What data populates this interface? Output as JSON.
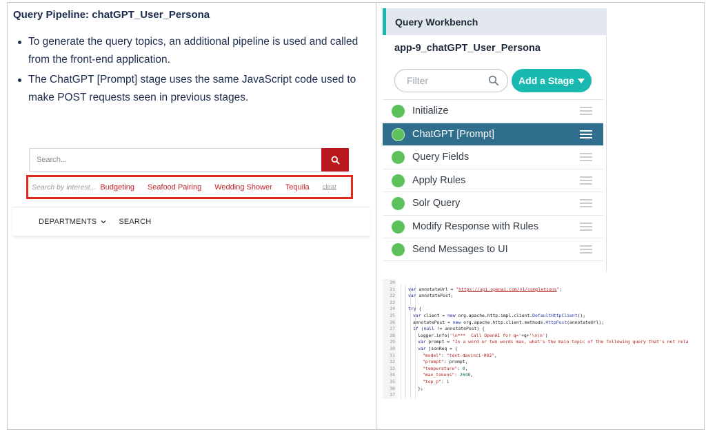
{
  "slide": {
    "heading": "Query Pipeline: chatGPT_User_Persona",
    "bullets": [
      "To generate the query topics, an additional pipeline is used and called from the front-end application.",
      "The ChatGPT [Prompt] stage uses the same JavaScript code used to make POST requests seen in previous stages."
    ]
  },
  "storefront": {
    "search_placeholder": "Search...",
    "search_button_icon": "search-icon",
    "interest_hint": "Search by interest...",
    "interests": [
      "Budgeting",
      "Seafood Pairing",
      "Wedding Shower",
      "Tequila"
    ],
    "clear_label": "clear",
    "nav": [
      "DEPARTMENTS",
      "SEARCH"
    ],
    "accent_color": "#b8191e",
    "highlight_color": "#e0281c"
  },
  "workbench": {
    "title": "Query Workbench",
    "app_name": "app-9_chatGPT_User_Persona",
    "filter_placeholder": "Filter",
    "add_stage_label": "Add a Stage",
    "accent_color": "#19b9b0",
    "stages": [
      {
        "label": "Initialize",
        "status": "enabled"
      },
      {
        "label": "ChatGPT [Prompt]",
        "status": "enabled",
        "selected": true
      },
      {
        "label": "Query Fields",
        "status": "enabled"
      },
      {
        "label": "Apply Rules",
        "status": "enabled"
      },
      {
        "label": "Solr Query",
        "status": "enabled"
      },
      {
        "label": "Modify Response with Rules",
        "status": "enabled"
      },
      {
        "label": "Send Messages to UI",
        "status": "enabled"
      }
    ]
  },
  "code": {
    "lines": [
      {
        "n": "20",
        "indent": 0,
        "tokens": []
      },
      {
        "n": "21",
        "indent": 1,
        "tokens": [
          [
            "k",
            "var "
          ],
          [
            "p",
            "annotateUrl = "
          ],
          [
            "s",
            "\""
          ],
          [
            "u",
            "https://api.openai.com/v1/completions"
          ],
          [
            "s",
            "\""
          ],
          [
            "p",
            ";"
          ]
        ]
      },
      {
        "n": "22",
        "indent": 1,
        "tokens": [
          [
            "k",
            "var "
          ],
          [
            "p",
            "annotatePost;"
          ]
        ]
      },
      {
        "n": "23",
        "indent": 0,
        "tokens": []
      },
      {
        "n": "24",
        "indent": 1,
        "tokens": [
          [
            "k",
            "try "
          ],
          [
            "p",
            "{"
          ]
        ]
      },
      {
        "n": "25",
        "indent": 2,
        "tokens": [
          [
            "k",
            "var "
          ],
          [
            "p",
            "client = "
          ],
          [
            "k",
            "new "
          ],
          [
            "p",
            "org.apache.http.impl.client."
          ],
          [
            "c",
            "DefaultHttpClient"
          ],
          [
            "p",
            "();"
          ]
        ]
      },
      {
        "n": "26",
        "indent": 2,
        "tokens": [
          [
            "p",
            "annotatePost = "
          ],
          [
            "k",
            "new "
          ],
          [
            "p",
            "org.apache.http.client.methods."
          ],
          [
            "c",
            "HttpPost"
          ],
          [
            "p",
            "(annotateUrl);"
          ]
        ]
      },
      {
        "n": "27",
        "indent": 2,
        "tokens": [
          [
            "k",
            "if "
          ],
          [
            "p",
            "("
          ],
          [
            "k",
            "null "
          ],
          [
            "p",
            "!= annotatePost) {"
          ]
        ]
      },
      {
        "n": "28",
        "indent": 3,
        "tokens": [
          [
            "p",
            "logger.info("
          ],
          [
            "s",
            "'\\n***  Call OpenAI for q='"
          ],
          [
            "p",
            "+q+"
          ],
          [
            "s",
            "'\\n\\n'"
          ],
          [
            "p",
            ")"
          ]
        ]
      },
      {
        "n": "29",
        "indent": 3,
        "tokens": [
          [
            "k",
            "var "
          ],
          [
            "p",
            "prompt = "
          ],
          [
            "s",
            "\"In a word or two words max, what's the main topic of the following query that's not rela"
          ]
        ]
      },
      {
        "n": "30",
        "indent": 3,
        "tokens": [
          [
            "k",
            "var "
          ],
          [
            "p",
            "jsonReq = {"
          ]
        ]
      },
      {
        "n": "31",
        "indent": 4,
        "tokens": [
          [
            "s",
            "\"model\""
          ],
          [
            "p",
            ": "
          ],
          [
            "s",
            "\"text-davinci-003\""
          ],
          [
            "p",
            ","
          ]
        ]
      },
      {
        "n": "32",
        "indent": 4,
        "tokens": [
          [
            "s",
            "\"prompt\""
          ],
          [
            "p",
            ": prompt,"
          ]
        ]
      },
      {
        "n": "33",
        "indent": 4,
        "tokens": [
          [
            "s",
            "\"temperature\""
          ],
          [
            "p",
            ": "
          ],
          [
            "n",
            "0"
          ],
          [
            "p",
            ","
          ]
        ]
      },
      {
        "n": "34",
        "indent": 4,
        "tokens": [
          [
            "s",
            "\"max_tokens\""
          ],
          [
            "p",
            ": "
          ],
          [
            "n",
            "2048"
          ],
          [
            "p",
            ","
          ]
        ]
      },
      {
        "n": "35",
        "indent": 4,
        "tokens": [
          [
            "s",
            "\"top_p\""
          ],
          [
            "p",
            ": "
          ],
          [
            "n",
            "1"
          ]
        ]
      },
      {
        "n": "36",
        "indent": 3,
        "tokens": [
          [
            "p",
            "};"
          ]
        ]
      },
      {
        "n": "37",
        "indent": 0,
        "tokens": []
      }
    ]
  }
}
